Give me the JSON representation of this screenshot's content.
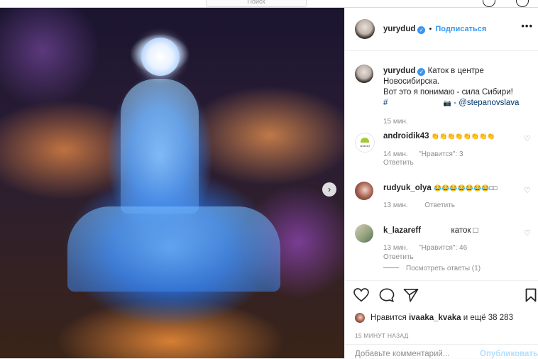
{
  "topbar": {
    "search_placeholder": "Поиск"
  },
  "post": {
    "username": "yurydud",
    "follow_label": "Подписаться",
    "more_label": "•••",
    "caption_line1": "Каток в центре",
    "caption_line2": "Новосибирска.",
    "caption_line3": "Вот это я понимаю - сила Сибири!",
    "hashtag": "#",
    "mention": "- @stepanovslava",
    "caption_time": "15 мин."
  },
  "comments": [
    {
      "user": "androidik43",
      "text": "👏👏👏👏👏👏👏👏",
      "time": "14 мин.",
      "likes": "\"Нравится\": 3",
      "reply": "Ответить"
    },
    {
      "user": "rudyuk_olya",
      "text": "😂😂😂😂😂😂😂□□",
      "time": "13 мин.",
      "reply": "Ответить"
    },
    {
      "user": "k_lazareff",
      "text": "каток □",
      "time": "13 мин.",
      "likes": "\"Нравится\": 46",
      "reply": "Ответить",
      "view_replies": "Посмотреть ответы (1)"
    }
  ],
  "likes_line": {
    "prefix": "Нравится",
    "user": "ivaaka_kvaka",
    "suffix": "и ещё 38 283"
  },
  "post_time": "15 МИНУТ НАЗАД",
  "add_comment": {
    "placeholder": "Добавьте комментарий...",
    "publish_label": "Опубликовать"
  },
  "colors": {
    "accent": "#3897f0",
    "text": "#262626",
    "muted": "#8e8e8e"
  }
}
